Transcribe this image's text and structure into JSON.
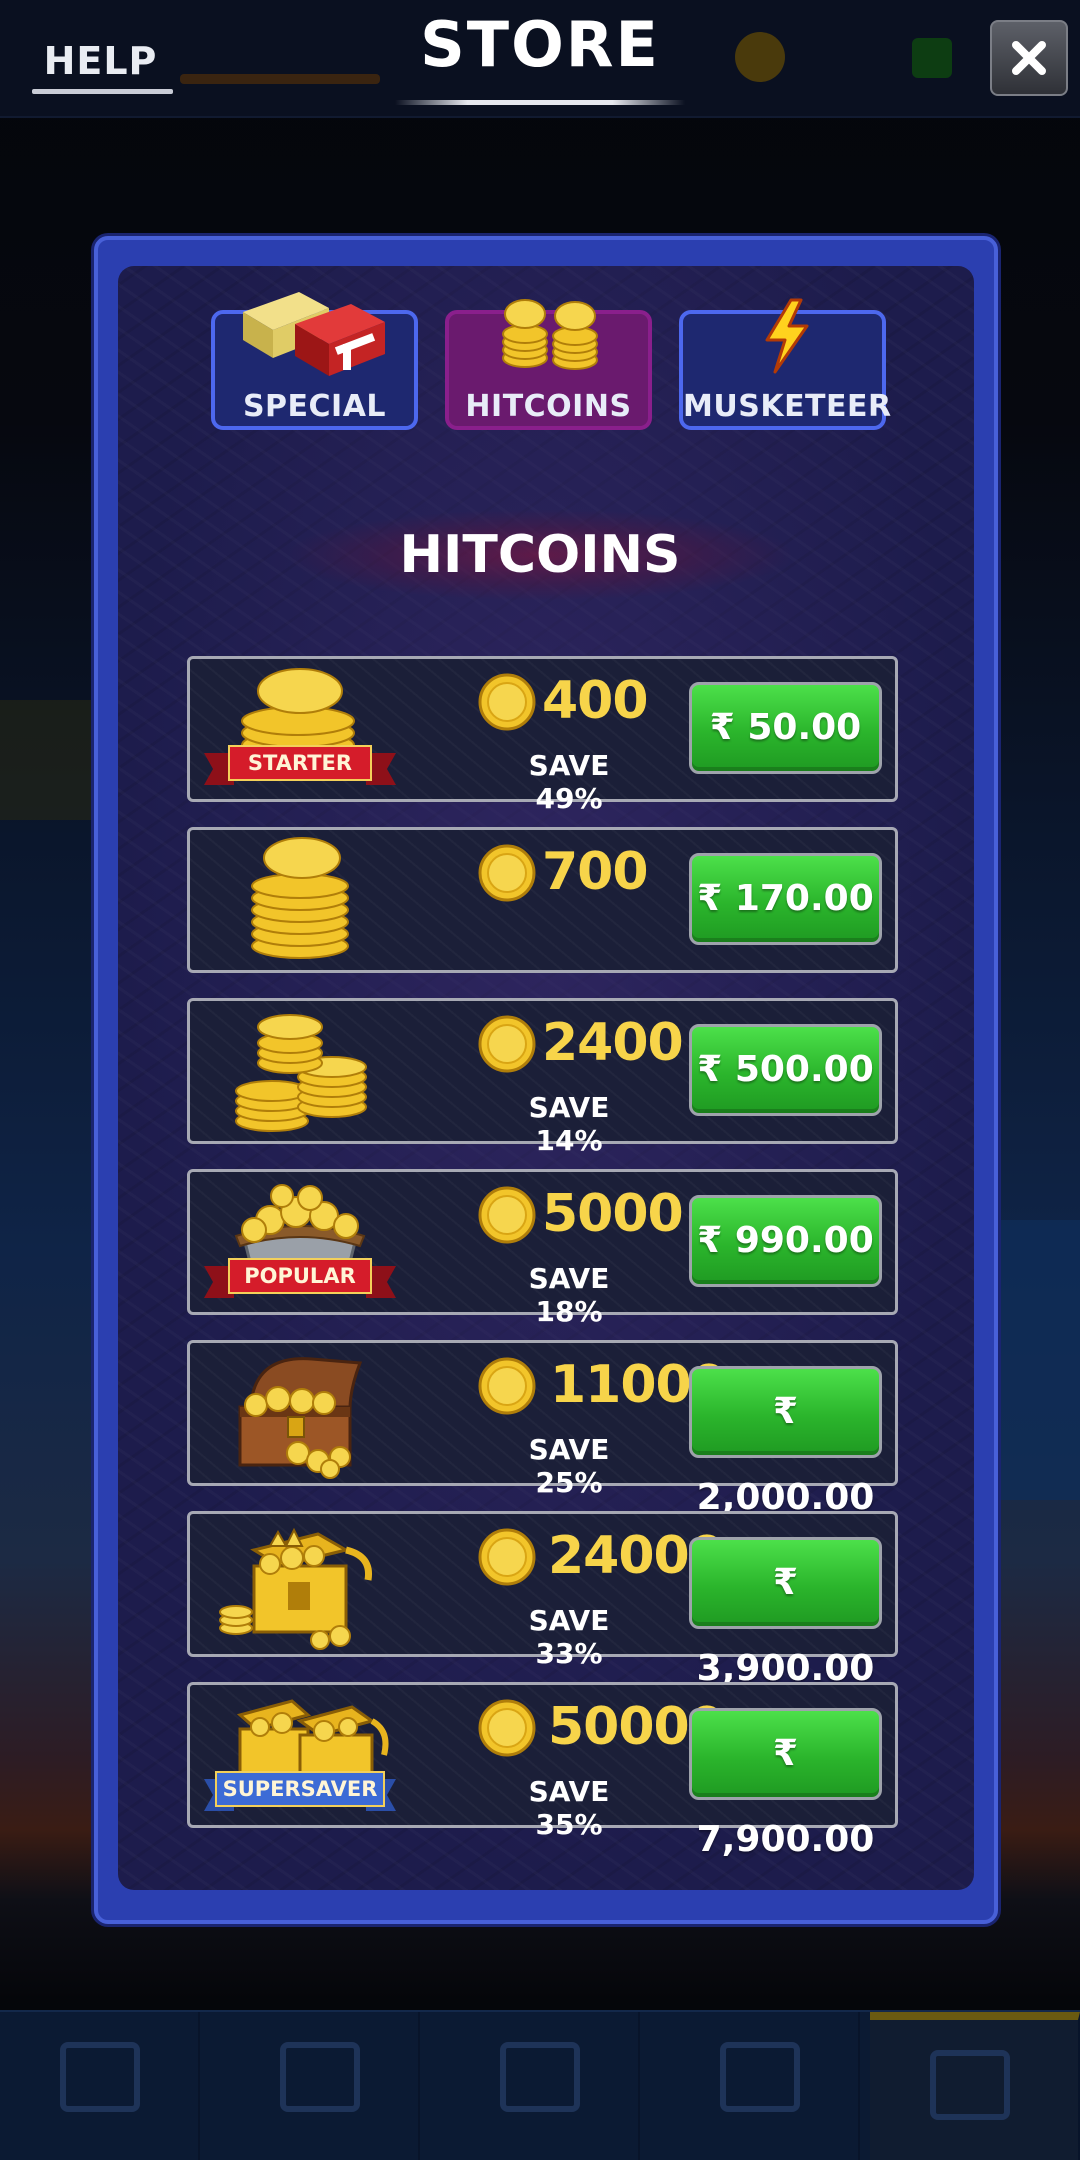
{
  "header": {
    "help_label": "HELP",
    "title": "STORE",
    "close_icon": "close-icon"
  },
  "tabs": [
    {
      "label": "SPECIAL",
      "icon": "chest-icon",
      "active": false
    },
    {
      "label": "HITCOINS",
      "icon": "coins-icon",
      "active": true
    },
    {
      "label": "MUSKETEER",
      "icon": "lightning-icon",
      "active": false
    }
  ],
  "section": {
    "title": "HITCOINS"
  },
  "offers": [
    {
      "badge": "STARTER",
      "amount": "400",
      "save": "SAVE 49%",
      "price": "₹ 50.00",
      "art": "coin-stack-icon"
    },
    {
      "badge": "",
      "amount": "700",
      "save": "",
      "price": "₹ 170.00",
      "art": "coin-stack-icon"
    },
    {
      "badge": "",
      "amount": "2400",
      "save": "SAVE 14%",
      "price": "₹ 500.00",
      "art": "coin-piles-icon"
    },
    {
      "badge": "POPULAR",
      "amount": "5000",
      "save": "SAVE 18%",
      "price": "₹ 990.00",
      "art": "coin-bowl-icon"
    },
    {
      "badge": "",
      "amount": "11000",
      "save": "SAVE 25%",
      "price": "₹ 2,000.00",
      "art": "treasure-chest-icon"
    },
    {
      "badge": "",
      "amount": "24000",
      "save": "SAVE 33%",
      "price": "₹ 3,900.00",
      "art": "gold-chest-icon"
    },
    {
      "badge": "SUPERSAVER",
      "amount": "50000",
      "save": "SAVE 35%",
      "price": "₹ 7,900.00",
      "art": "double-chest-icon"
    }
  ],
  "colors": {
    "accent_gold": "#f7d44a",
    "buy_green": "#2bb52c",
    "modal_blue": "#2b3fb0",
    "active_tab": "#6a1a6e"
  }
}
